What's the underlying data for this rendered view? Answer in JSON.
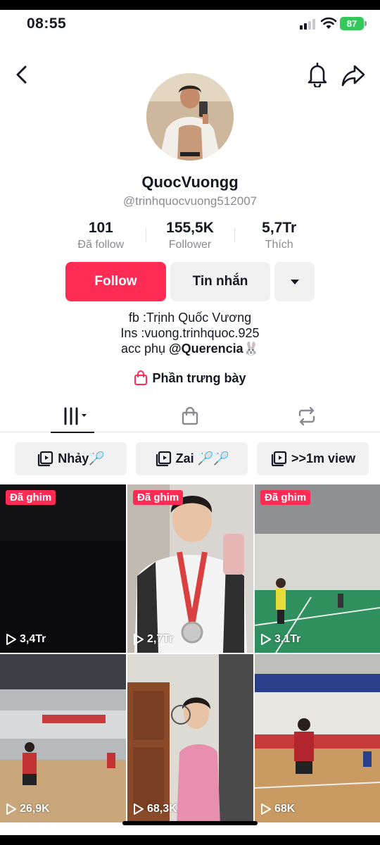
{
  "status_bar": {
    "time": "08:55",
    "battery": "87"
  },
  "profile": {
    "display_name": "QuocVuongg",
    "handle": "@trinhquocvuong512007",
    "stats": [
      {
        "value": "101",
        "label": "Đã follow"
      },
      {
        "value": "155,5K",
        "label": "Follower"
      },
      {
        "value": "5,7Tr",
        "label": "Thích"
      }
    ],
    "follow_label": "Follow",
    "message_label": "Tin nhắn",
    "bio_line1": "fb :Trịnh Quốc Vương",
    "bio_line2": "Ins :vuong.trinhquoc.925",
    "bio_line3_prefix": "acc phụ ",
    "bio_mention": "@Querencia🐰",
    "showcase_label": "Phần trưng bày"
  },
  "playlists": [
    {
      "label": "Nhảy🏸"
    },
    {
      "label": "Zai 🏸🏸"
    },
    {
      "label": ">>1m view"
    }
  ],
  "videos": [
    {
      "pinned": "Đã ghim",
      "views": "3,4Tr"
    },
    {
      "pinned": "Đã ghim",
      "views": "2,7Tr"
    },
    {
      "pinned": "Đã ghim",
      "views": "3,1Tr"
    },
    {
      "pinned": "",
      "views": "26,9K"
    },
    {
      "pinned": "",
      "views": "68,3K"
    },
    {
      "pinned": "",
      "views": "68K"
    }
  ],
  "colors": {
    "accent": "#fe2c55",
    "chip_bg": "#f1f1f2",
    "muted_text": "#8a8b91"
  }
}
